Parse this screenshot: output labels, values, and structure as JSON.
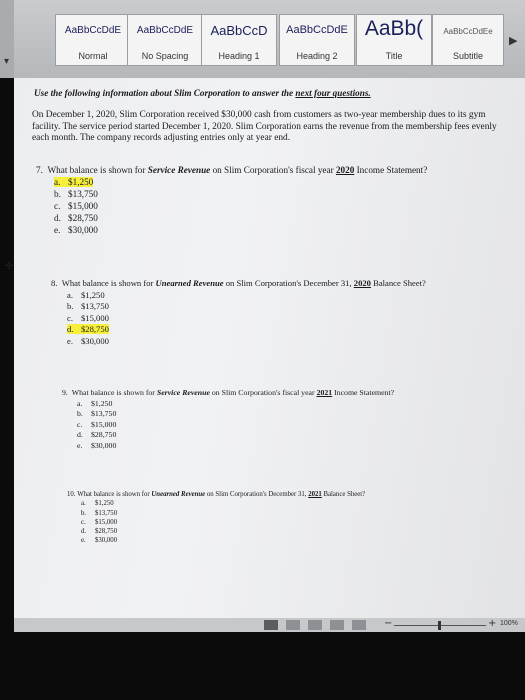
{
  "ribbon": {
    "styles": [
      {
        "sample": "AaBbCcDdE",
        "name": "Normal"
      },
      {
        "sample": "AaBbCcDdE",
        "name": "No Spacing"
      },
      {
        "sample": "AaBbCcD",
        "name": "Heading 1"
      },
      {
        "sample": "AaBbCcDdE",
        "name": "Heading 2"
      },
      {
        "sample": "AaBb(",
        "name": "Title"
      },
      {
        "sample": "AaBbCcDdEe",
        "name": "Subtitle"
      }
    ]
  },
  "document": {
    "instruction_prefix": "Use the following information about Slim Corporation to answer the ",
    "instruction_emph": "next four questions.",
    "intro": "On December 1, 2020, Slim Corporation received $30,000 cash from customers as two-year membership dues to its gym facility. The service period started December 1, 2020. Slim Corporation earns the revenue from the membership fees evenly each month. The company records adjusting entries only at year end.",
    "questions": [
      {
        "number": "7.",
        "prefix": "What balance is shown for ",
        "account": "Service Revenue",
        "middle": " on Slim Corporation's fiscal year ",
        "year": "2020",
        "suffix": " Income Statement?",
        "choices": [
          {
            "letter": "a.",
            "text": "$1,250",
            "highlighted": true
          },
          {
            "letter": "b.",
            "text": "$13,750",
            "highlighted": false
          },
          {
            "letter": "c.",
            "text": "$15,000",
            "highlighted": false
          },
          {
            "letter": "d.",
            "text": "$28,750",
            "highlighted": false
          },
          {
            "letter": "e.",
            "text": "$30,000",
            "highlighted": false
          }
        ]
      },
      {
        "number": "8.",
        "prefix": "What balance is shown for ",
        "account": "Unearned Revenue",
        "middle": " on Slim Corporation's December 31, ",
        "year": "2020",
        "suffix": " Balance Sheet?",
        "choices": [
          {
            "letter": "a.",
            "text": "$1,250",
            "highlighted": false
          },
          {
            "letter": "b.",
            "text": "$13,750",
            "highlighted": false
          },
          {
            "letter": "c.",
            "text": "$15,000",
            "highlighted": false
          },
          {
            "letter": "d.",
            "text": "$28,750",
            "highlighted": true
          },
          {
            "letter": "e.",
            "text": "$30,000",
            "highlighted": false
          }
        ]
      },
      {
        "number": "9.",
        "prefix": "What balance is shown for ",
        "account": "Service Revenue",
        "middle": " on Slim Corporation's fiscal year ",
        "year": "2021",
        "suffix": " Income Statement?",
        "choices": [
          {
            "letter": "a.",
            "text": "$1,250",
            "highlighted": false
          },
          {
            "letter": "b.",
            "text": "$13,750",
            "highlighted": false
          },
          {
            "letter": "c.",
            "text": "$15,000",
            "highlighted": false
          },
          {
            "letter": "d.",
            "text": "$28,750",
            "highlighted": false
          },
          {
            "letter": "e.",
            "text": "$30,000",
            "highlighted": false
          }
        ]
      },
      {
        "number": "10.",
        "prefix": "What balance is shown for ",
        "account": "Unearned Revenue",
        "middle": " on Slim Corporation's December 31, ",
        "year": "2021",
        "suffix": " Balance Sheet?",
        "choices": [
          {
            "letter": "a.",
            "text": "$1,250",
            "highlighted": false
          },
          {
            "letter": "b.",
            "text": "$13,750",
            "highlighted": false
          },
          {
            "letter": "c.",
            "text": "$15,000",
            "highlighted": false
          },
          {
            "letter": "d.",
            "text": "$28,750",
            "highlighted": false
          },
          {
            "letter": "e.",
            "text": "$30,000",
            "highlighted": false
          }
        ]
      }
    ]
  },
  "status_bar": {
    "zoom": "100%",
    "zoom_minus": "−",
    "zoom_plus": "+"
  },
  "colors": {
    "highlight": "#f6ef3c",
    "style_sample": "#1b1f5a"
  }
}
